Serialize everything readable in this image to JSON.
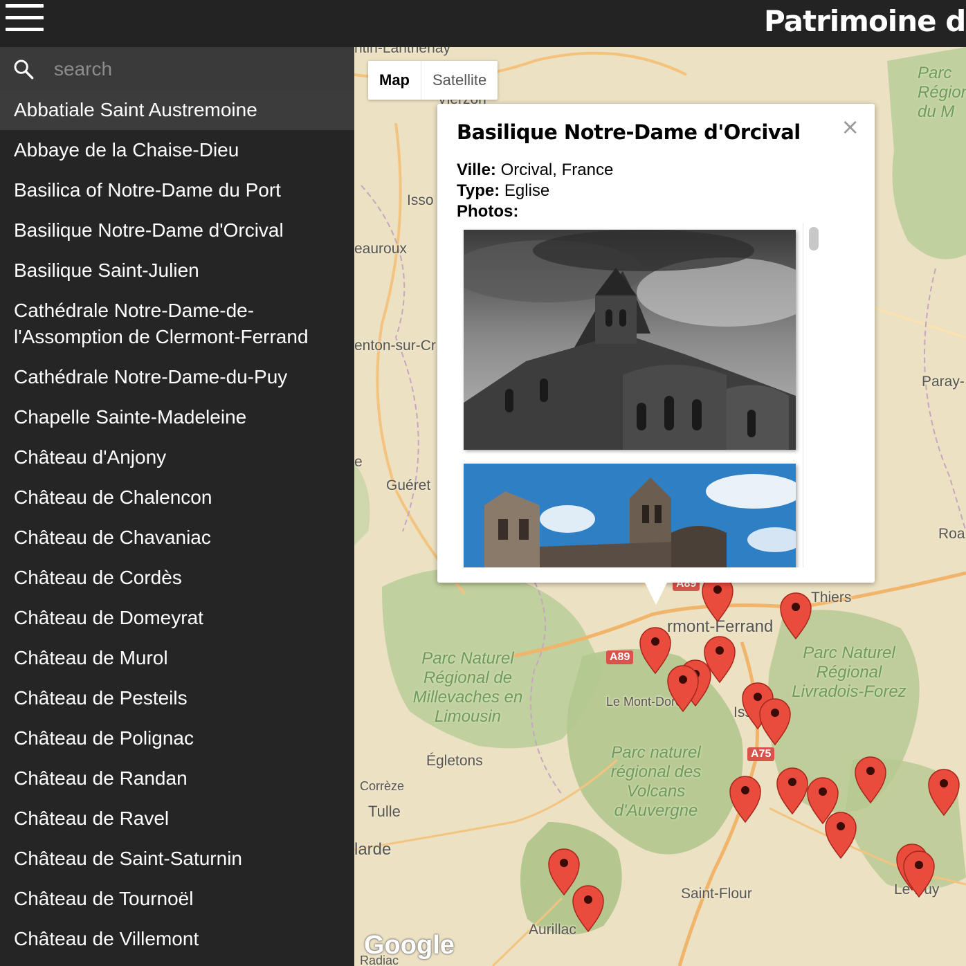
{
  "header": {
    "title": "Patrimoine d'Auvergne"
  },
  "search": {
    "placeholder": "search"
  },
  "sidebar": {
    "items": [
      "Abbatiale Saint Austremoine",
      "Abbaye de la Chaise-Dieu",
      "Basilica of Notre-Dame du Port",
      "Basilique Notre-Dame d'Orcival",
      "Basilique Saint-Julien",
      "Cathédrale Notre-Dame-de-l'Assomption de Clermont-Ferrand",
      "Cathédrale Notre-Dame-du-Puy",
      "Chapelle Sainte-Madeleine",
      "Château d'Anjony",
      "Château de Chalencon",
      "Château de Chavaniac",
      "Château de Cordès",
      "Château de Domeyrat",
      "Château de Murol",
      "Château de Pesteils",
      "Château de Polignac",
      "Château de Randan",
      "Château de Ravel",
      "Château de Saint-Saturnin",
      "Château de Tournoël",
      "Château de Villemont"
    ]
  },
  "map": {
    "map_type": {
      "map": "Map",
      "satellite": "Satellite"
    },
    "labels": [
      "ntin-Lanthenay",
      "Vierzon",
      "Isso",
      "eauroux",
      "enton-sur-Cr",
      "e",
      "Guéret",
      "Paray-",
      "Roa",
      "Thiers",
      "rmont-Ferrand",
      "Le Mont-Dore",
      "Iss",
      "Égletons",
      "Corrèze",
      "Tulle",
      "larde",
      "Saint-Flour",
      "Aurillac",
      "Le Puy",
      "Radiac"
    ],
    "parks": [
      "Parc Naturel Régional de Millevaches en Limousin",
      "Parc Naturel Régional Livradois-Forez",
      "Parc naturel régional des Volcans d'Auvergne",
      "Parc Régional du M"
    ],
    "roads": [
      "A89",
      "A75",
      "A89"
    ],
    "attribution": "Google"
  },
  "infowindow": {
    "title": "Basilique Notre-Dame d'Orcival",
    "ville_label": "Ville:",
    "ville": "Orcival, France",
    "type_label": "Type:",
    "type": "Eglise",
    "photos_label": "Photos:",
    "close": "×"
  }
}
